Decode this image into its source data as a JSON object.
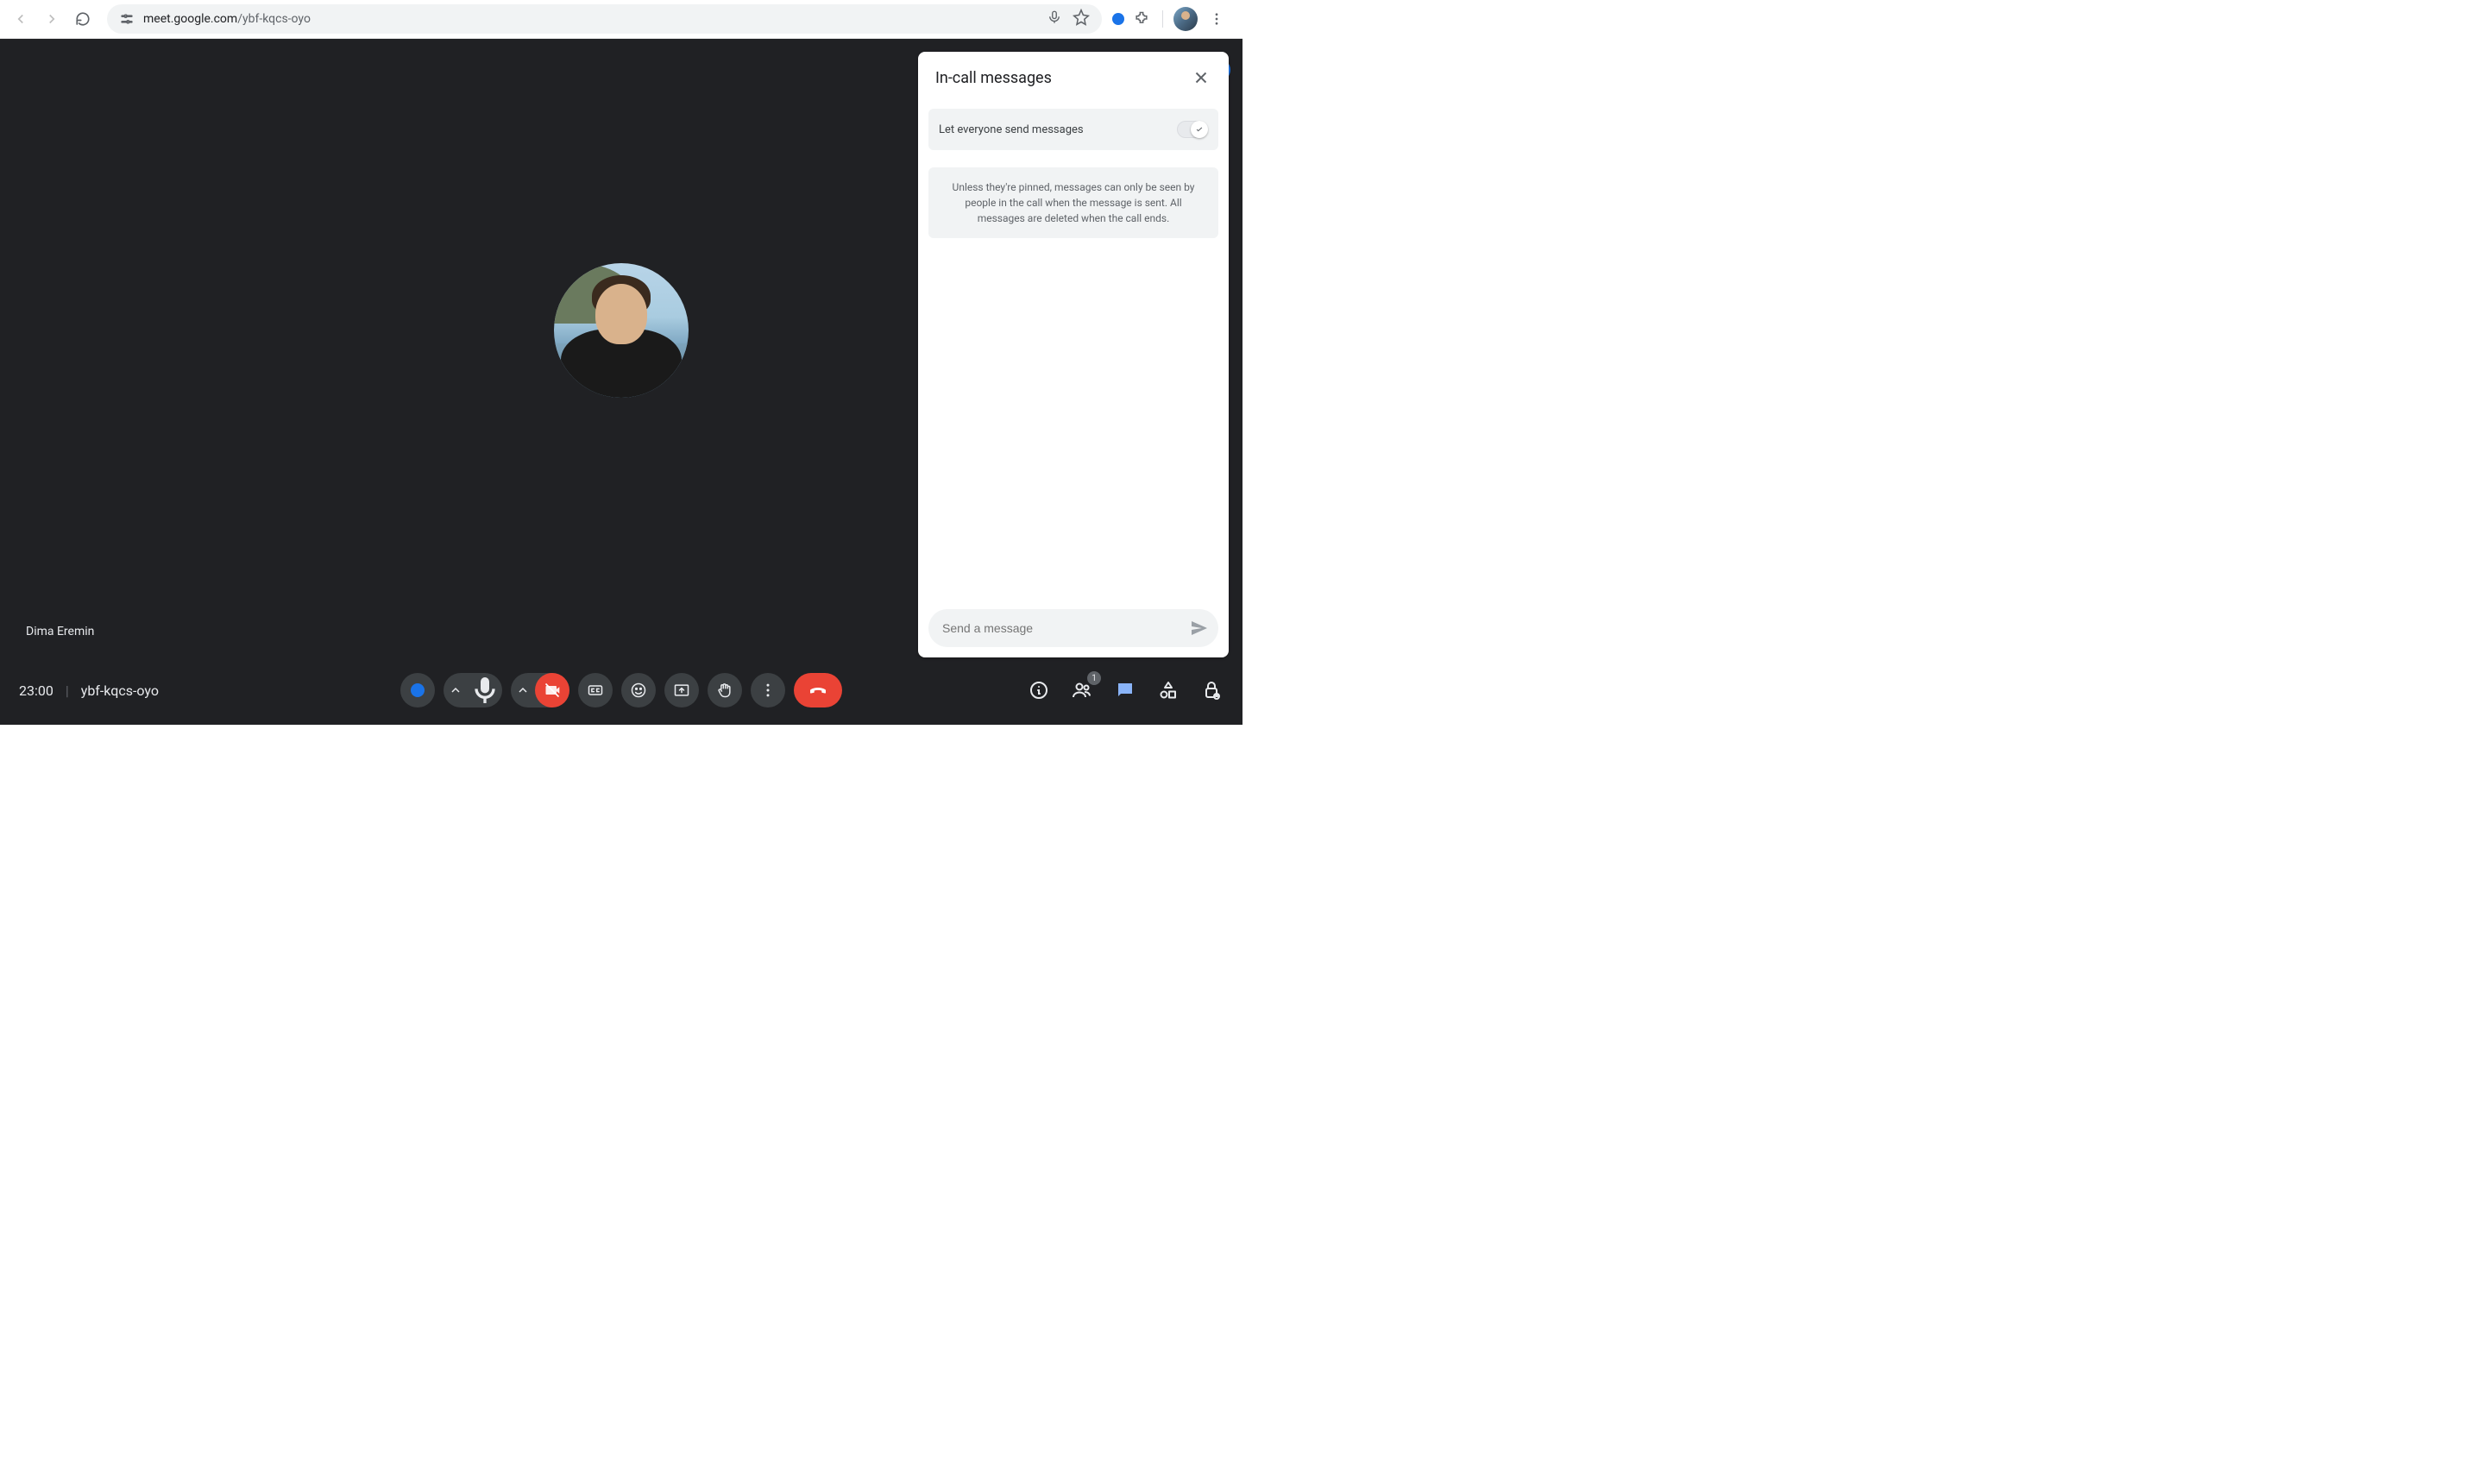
{
  "browser": {
    "url_host": "meet.google.com",
    "url_path": "/ybf-kqcs-oyo"
  },
  "participant": {
    "name": "Dima Eremin"
  },
  "bottom": {
    "time": "23:00",
    "meeting_code": "ybf-kqcs-oyo",
    "people_count": "1"
  },
  "chat": {
    "title": "In-call messages",
    "setting_label": "Let everyone send messages",
    "notice": "Unless they're pinned, messages can only be seen by people in the call when the message is sent. All messages are deleted when the call ends.",
    "input_placeholder": "Send a message"
  }
}
